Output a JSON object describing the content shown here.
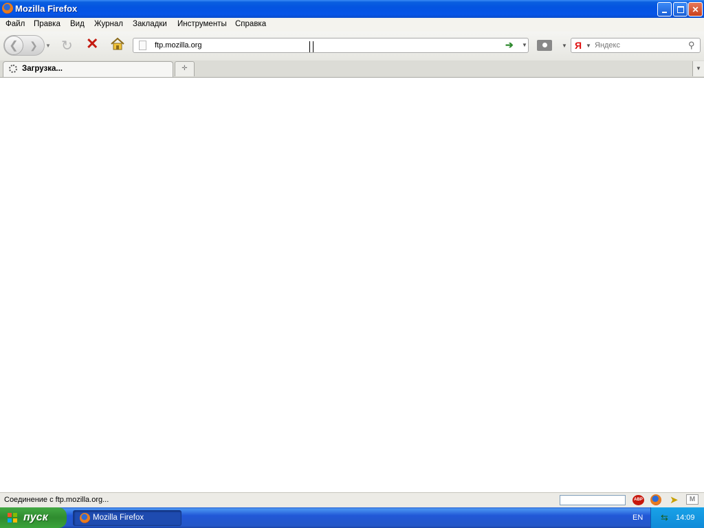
{
  "window": {
    "title": "Mozilla Firefox"
  },
  "menubar": {
    "items": [
      "Файл",
      "Правка",
      "Вид",
      "Журнал",
      "Закладки",
      "Инструменты",
      "Справка"
    ]
  },
  "navbar": {
    "url": "ftp.mozilla.org",
    "search_engine": "Я",
    "search_placeholder": "Яндекс"
  },
  "tabs": [
    {
      "label": "Загрузка...",
      "loading": true
    }
  ],
  "statusbar": {
    "text": "Соединение с ftp.mozilla.org..."
  },
  "statusbar_icons": {
    "abp": "ABP",
    "gmail": "M"
  },
  "taskbar": {
    "start_label": "пуск",
    "task_label": "Mozilla Firefox",
    "lang": "EN",
    "clock": "14:09"
  },
  "colors": {
    "titlebar": "#0454e0",
    "stop": "#c41a10",
    "go": "#2f8a2f",
    "taskbar": "#2457c8",
    "start": "#2f8c2f"
  }
}
